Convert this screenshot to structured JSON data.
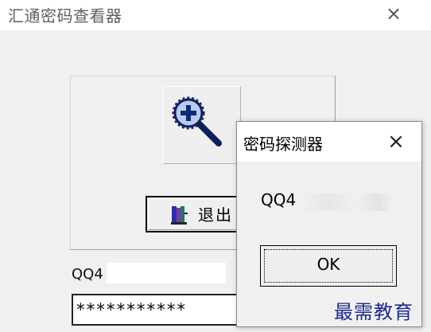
{
  "main_window": {
    "title": "汇通密码查看器",
    "close_glyph": "×",
    "qq_label": "QQ4",
    "password_mask": "***********",
    "search_button_icon": "magnifier-plus-icon",
    "exit_button": {
      "icon": "exit-door-icon",
      "label": "退出"
    }
  },
  "popup": {
    "title": "密码探测器",
    "close_glyph": "×",
    "message": "QQ4",
    "ok_label": "OK"
  },
  "watermark": {
    "text": "最需教育"
  },
  "colors": {
    "window_bg": "#f0f0f0",
    "titlebar_bg": "#ffffff",
    "icon_navy": "#102a7a",
    "watermark": "#1e2a8a"
  }
}
